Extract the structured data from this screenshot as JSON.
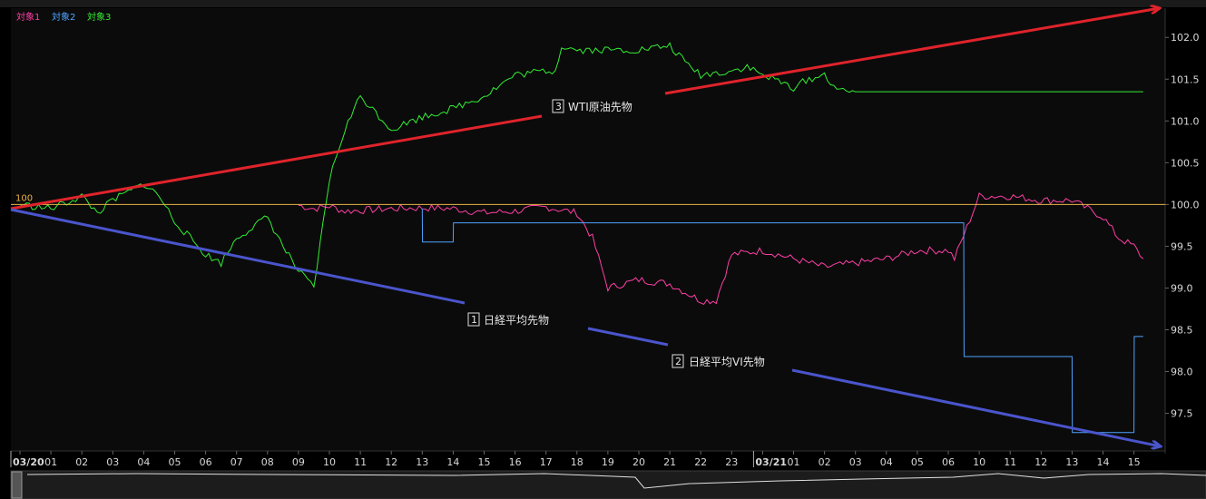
{
  "legend": [
    {
      "label": "対象1",
      "color": "#ff3fa6"
    },
    {
      "label": "対象2",
      "color": "#4fa3ff"
    },
    {
      "label": "対象3",
      "color": "#33ee33"
    }
  ],
  "colors": {
    "background": "#0a0a0a",
    "baseline": "#e8b34a",
    "arrow_red": "#e0232b",
    "arrow_blue": "#4a55cc",
    "axis_text": "#d8d8d8"
  },
  "annotations": [
    {
      "number": "3",
      "label": "WTI原油先物"
    },
    {
      "number": "1",
      "label": "日経平均先物"
    },
    {
      "number": "2",
      "label": "日経平均VI先物"
    }
  ],
  "chart_data": {
    "type": "line",
    "baseline_label": "100",
    "ylim": [
      97.05,
      102.35
    ],
    "y_ticks": [
      97.5,
      98.0,
      98.5,
      99.0,
      99.5,
      100.0,
      100.5,
      101.0,
      101.5,
      102.0
    ],
    "y_tick_labels": [
      "97.5",
      "98.0",
      "98.5",
      "99.0",
      "99.5",
      "100.0",
      "100.5",
      "101.0",
      "101.5",
      "102.0"
    ],
    "x_tick_labels": [
      "03/20",
      "01",
      "02",
      "03",
      "04",
      "05",
      "06",
      "07",
      "08",
      "09",
      "10",
      "11",
      "12",
      "13",
      "14",
      "15",
      "16",
      "17",
      "18",
      "19",
      "20",
      "21",
      "22",
      "23",
      "03/21",
      "01",
      "02",
      "03",
      "04",
      "05",
      "06",
      "10",
      "11",
      "12",
      "13",
      "14",
      "15"
    ],
    "x_tick_hours": [
      0,
      1,
      2,
      3,
      4,
      5,
      6,
      7,
      8,
      9,
      10,
      11,
      12,
      13,
      14,
      15,
      16,
      17,
      18,
      19,
      20,
      21,
      22,
      23,
      24,
      25,
      26,
      27,
      28,
      29,
      30,
      31,
      32,
      33,
      34,
      35,
      36
    ],
    "series": [
      {
        "name": "対象1",
        "x": [
          9.0,
          9.5,
          10.0,
          10.5,
          11.0,
          12.0,
          13.0,
          14.0,
          15.0,
          16.0,
          17.0,
          18.0,
          18.5,
          19.0,
          19.5,
          20.0,
          21.0,
          22.0,
          22.5,
          23.0,
          24.0,
          25.0,
          26.0,
          27.0,
          28.0,
          29.0,
          30.0,
          30.2,
          31.0,
          32.0,
          33.0,
          34.0,
          35.0,
          35.5,
          36.0,
          36.3
        ],
        "values": [
          99.99,
          99.95,
          99.98,
          99.92,
          99.93,
          99.95,
          99.96,
          99.95,
          99.9,
          99.92,
          99.97,
          99.9,
          99.6,
          99.0,
          99.05,
          99.1,
          99.05,
          98.85,
          98.85,
          99.4,
          99.45,
          99.35,
          99.25,
          99.3,
          99.35,
          99.45,
          99.45,
          99.35,
          100.1,
          100.1,
          100.05,
          100.05,
          99.85,
          99.6,
          99.5,
          99.35
        ]
      },
      {
        "name": "対象2",
        "x": [
          13.0,
          13.01,
          14.0,
          14.01,
          21.0,
          30.5,
          30.51,
          34.0,
          34.01,
          36.0,
          36.01,
          36.3
        ],
        "values": [
          99.95,
          99.55,
          99.55,
          99.78,
          99.78,
          99.78,
          98.18,
          98.18,
          97.27,
          97.27,
          98.42,
          98.42
        ]
      },
      {
        "name": "対象3",
        "x": [
          0.0,
          1.0,
          2.0,
          2.5,
          3.0,
          4.0,
          4.5,
          5.0,
          6.0,
          6.5,
          7.0,
          8.0,
          8.5,
          9.0,
          9.5,
          10.0,
          10.5,
          11.0,
          12.0,
          13.0,
          14.0,
          15.0,
          16.0,
          17.0,
          17.3,
          17.5,
          18.0,
          19.0,
          20.0,
          21.0,
          21.5,
          22.0,
          23.0,
          23.5,
          24.0,
          25.0,
          25.5,
          26.0,
          26.5,
          27.0,
          36.3
        ],
        "values": [
          100.0,
          99.95,
          100.1,
          99.9,
          100.05,
          100.25,
          100.1,
          99.8,
          99.4,
          99.3,
          99.6,
          99.85,
          99.5,
          99.2,
          99.0,
          100.3,
          100.9,
          101.3,
          100.9,
          101.05,
          101.15,
          101.3,
          101.55,
          101.6,
          101.6,
          101.9,
          101.85,
          101.85,
          101.85,
          101.9,
          101.7,
          101.55,
          101.6,
          101.65,
          101.55,
          101.4,
          101.5,
          101.55,
          101.35,
          101.35,
          101.35
        ]
      }
    ]
  }
}
